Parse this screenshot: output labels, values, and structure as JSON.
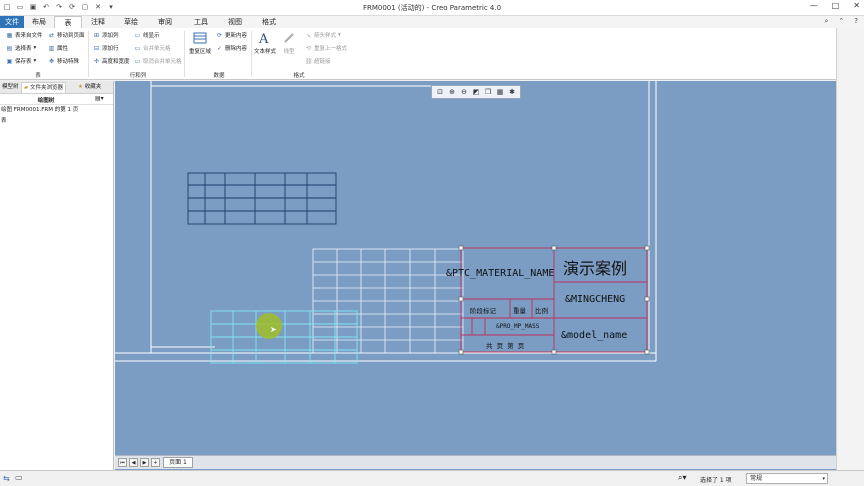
{
  "window": {
    "title": "FRM0001 (活动的) - Creo Parametric 4.0"
  },
  "tabs": [
    {
      "label": "文件"
    },
    {
      "label": "布局"
    },
    {
      "label": "表"
    },
    {
      "label": "注释"
    },
    {
      "label": "草绘"
    },
    {
      "label": "审阅"
    },
    {
      "label": "工具"
    },
    {
      "label": "视图"
    },
    {
      "label": "格式"
    }
  ],
  "ribbon": {
    "table": {
      "from_file": "表来自文件",
      "select_table": "选择表",
      "save_table": "保存表",
      "move_to_page": "移动到页面",
      "properties": "属性",
      "move_special": "移动特殊",
      "group_label": "表"
    },
    "rows_cols": {
      "add_column": "添加列",
      "add_row": "添加行",
      "height_width": "高度和宽度",
      "line_display": "线显示",
      "merge_cells": "合并单元格",
      "unmerge_cells": "取消合并单元格",
      "group_label": "行和列"
    },
    "data": {
      "repeat_region": "重复区域",
      "update_content": "更新内容",
      "delete_content": "删除内容",
      "group_label": "数据"
    },
    "format": {
      "text_style": "文本样式",
      "line_style": "线型",
      "arrow_style": "箭头样式",
      "repeat_last_format": "重复上一格式",
      "hyperlink": "超链接",
      "group_label": "格式"
    }
  },
  "left_panel": {
    "tabs": [
      "模型树",
      "文件夹浏览器",
      "收藏夹"
    ],
    "header": "绘图树",
    "rows": [
      "绘图 FRM0001.FRM 的第 1 页",
      "表"
    ]
  },
  "title_block": {
    "material": "&PTC_MATERIAL_NAME",
    "demo_title": "演示案例",
    "mingcheng": "&MINGCHENG",
    "model_name": "&model_name",
    "stage_mark": "阶段标记",
    "weight": "重量",
    "scale": "比例",
    "mass": "&PRO_MP_MASS",
    "sheets": "共 页 第 页"
  },
  "sheet_bar": {
    "active_sheet": "页面 1"
  },
  "status_bar": {
    "selection": "选择了 1 项",
    "filter": "常规"
  },
  "colors": {
    "canvas": "#7b9dc3",
    "file_tab": "#2f73b8",
    "selection": "#c0305a",
    "highlight": "#7fe8f0"
  }
}
